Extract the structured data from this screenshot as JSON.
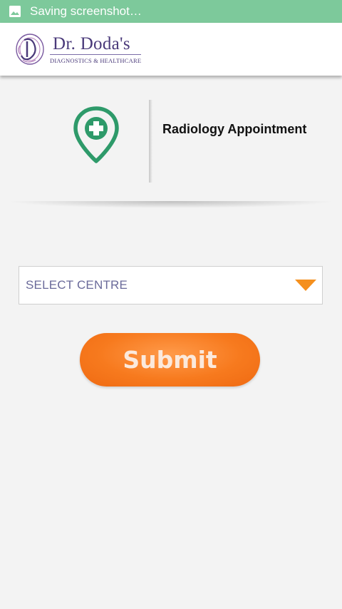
{
  "status_bar": {
    "text": "Saving screenshot…",
    "icon": "image-icon",
    "color": "#7dc99b"
  },
  "header": {
    "logo_name": "Dr. Doda's",
    "logo_tagline": "DIAGNOSTICS & HEALTHCARE",
    "brand_color": "#4a3a7a"
  },
  "service": {
    "icon": "location-plus-icon",
    "icon_color": "#2e9a6a",
    "title": "Radiology Appointment"
  },
  "form": {
    "select_centre": {
      "selected": "SELECT CENTRE",
      "arrow_color": "#f5901e"
    },
    "submit_label": "Submit",
    "submit_color": "#f77a1e"
  }
}
